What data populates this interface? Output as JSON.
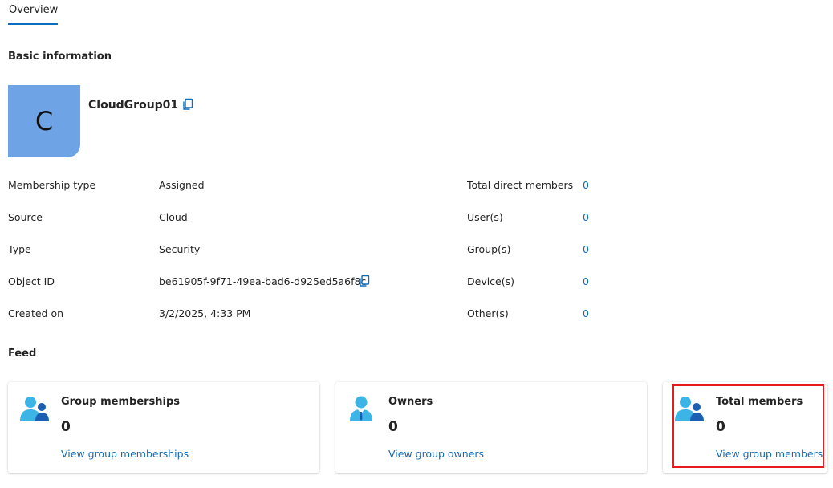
{
  "tabs": [
    {
      "label": "Overview",
      "active": true
    }
  ],
  "basic_info": {
    "title": "Basic information",
    "avatar_letter": "C",
    "avatar_color": "#6ea3e6",
    "group_name": "CloudGroup01"
  },
  "properties": [
    {
      "label": "Membership type",
      "value": "Assigned"
    },
    {
      "label": "Source",
      "value": "Cloud"
    },
    {
      "label": "Type",
      "value": "Security"
    },
    {
      "label": "Object ID",
      "value": "be61905f-9f71-49ea-bad6-d925ed5a6f8c"
    },
    {
      "label": "Created on",
      "value": "3/2/2025, 4:33 PM"
    }
  ],
  "counts": [
    {
      "label": "Total direct members",
      "value": "0"
    },
    {
      "label": "User(s)",
      "value": "0"
    },
    {
      "label": "Group(s)",
      "value": "0"
    },
    {
      "label": "Device(s)",
      "value": "0"
    },
    {
      "label": "Other(s)",
      "value": "0"
    }
  ],
  "feed": {
    "title": "Feed",
    "cards": [
      {
        "title": "Group memberships",
        "count": "0",
        "link": "View group memberships",
        "icon": "people-icon"
      },
      {
        "title": "Owners",
        "count": "0",
        "link": "View group owners",
        "icon": "person-icon"
      },
      {
        "title": "Total members",
        "count": "0",
        "link": "View group members",
        "icon": "people-icon"
      }
    ]
  },
  "colors": {
    "accent": "#0f6cbd",
    "highlight": "#e41c1c"
  }
}
